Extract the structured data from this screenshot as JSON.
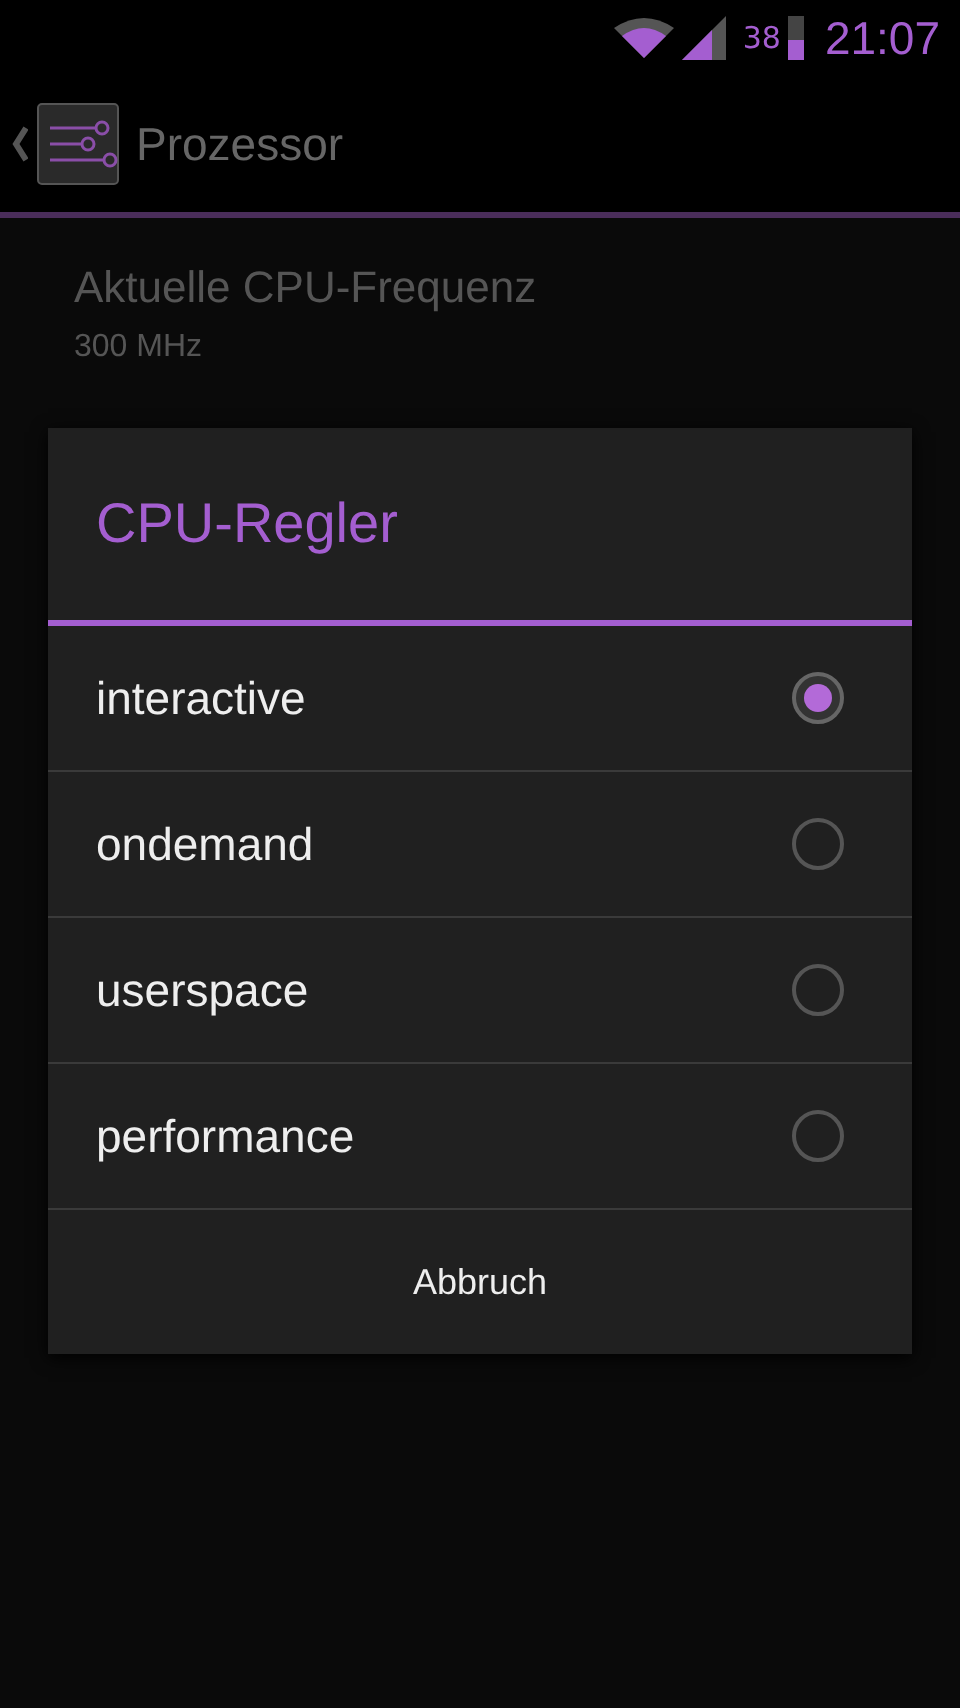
{
  "status_bar": {
    "battery": "38",
    "time": "21:07"
  },
  "action_bar": {
    "title": "Prozessor"
  },
  "settings": [
    {
      "title": "Aktuelle CPU-Frequenz",
      "summary": "300 MHz"
    }
  ],
  "dialog": {
    "title": "CPU-Regler",
    "options": [
      {
        "label": "interactive",
        "selected": true
      },
      {
        "label": "ondemand",
        "selected": false
      },
      {
        "label": "userspace",
        "selected": false
      },
      {
        "label": "performance",
        "selected": false
      }
    ],
    "cancel": "Abbruch"
  }
}
